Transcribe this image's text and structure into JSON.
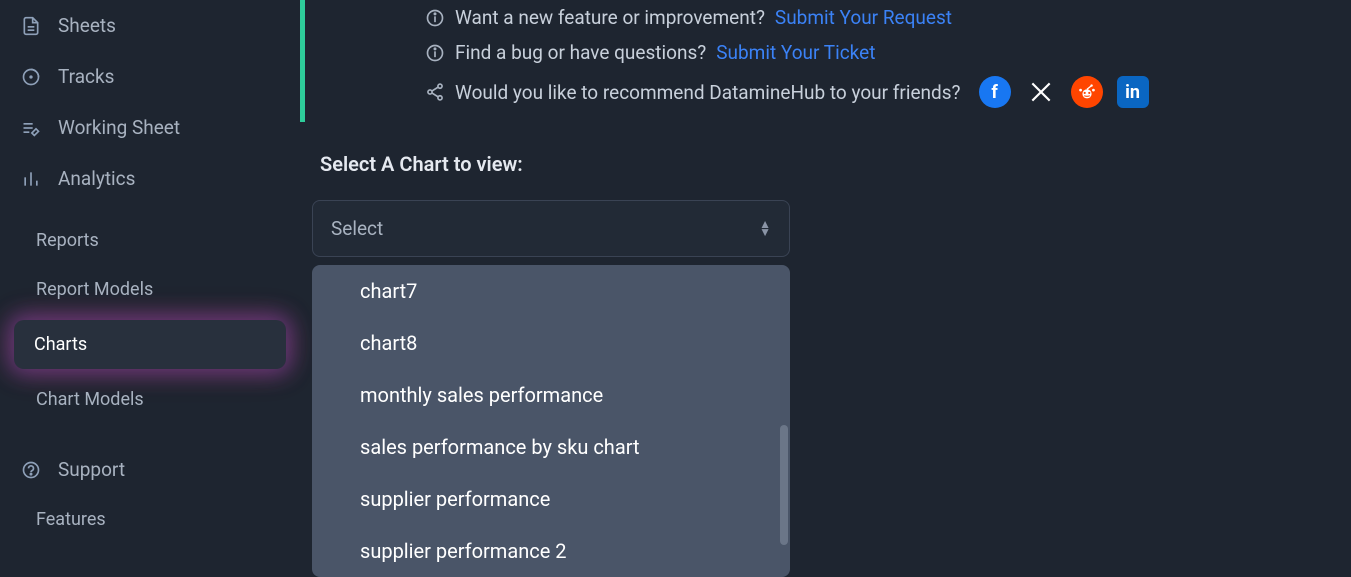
{
  "sidebar": {
    "items": [
      {
        "label": "Sheets"
      },
      {
        "label": "Tracks"
      },
      {
        "label": "Working Sheet"
      },
      {
        "label": "Analytics"
      }
    ],
    "subitems": [
      {
        "label": "Reports"
      },
      {
        "label": "Report Models"
      },
      {
        "label": "Charts"
      },
      {
        "label": "Chart Models"
      }
    ],
    "support": "Support",
    "features": "Features"
  },
  "banner": {
    "feature_text": "Want a new feature or improvement?",
    "feature_link": "Submit Your Request",
    "bug_text": "Find a bug or have questions?",
    "bug_link": "Submit Your Ticket",
    "share_text": "Would you like to recommend DatamineHub to your friends?"
  },
  "chart_section": {
    "label": "Select A Chart to view:",
    "placeholder": "Select",
    "options": [
      "chart7",
      "chart8",
      "monthly sales performance",
      "sales performance by sku chart",
      "supplier performance",
      "supplier performance 2"
    ]
  }
}
